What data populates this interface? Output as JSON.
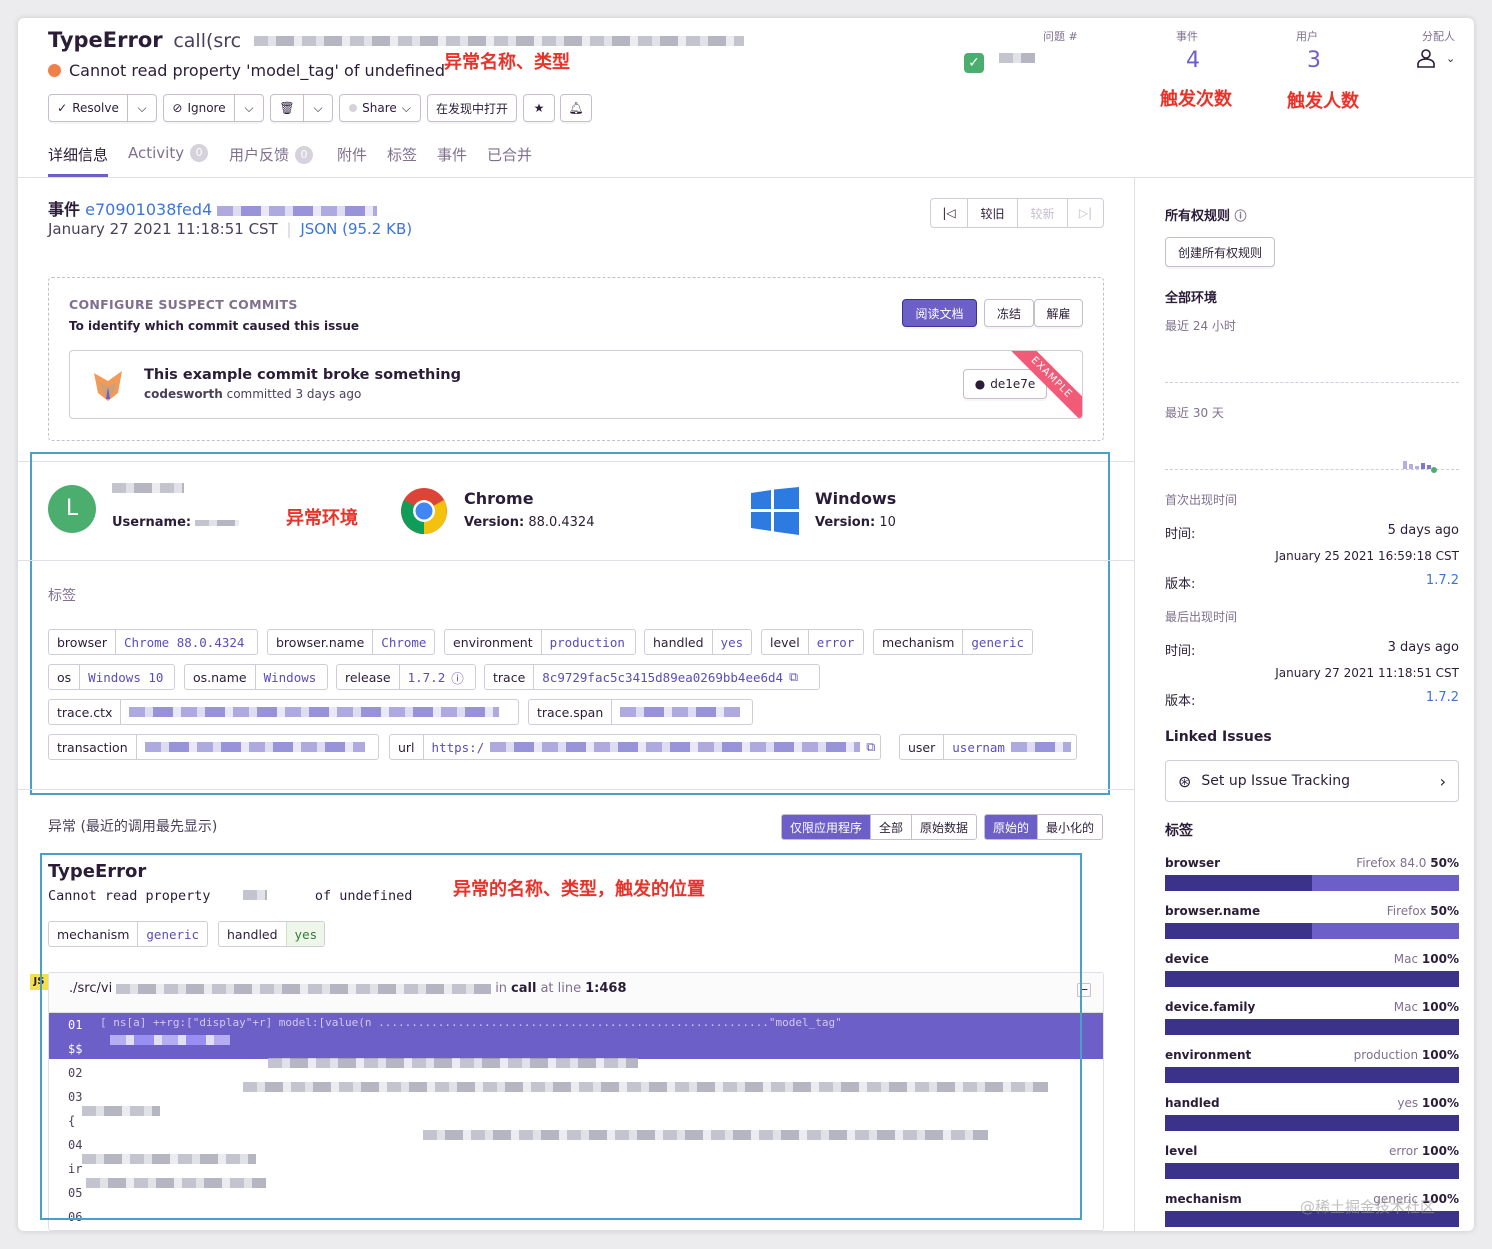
{
  "header": {
    "title": "TypeError",
    "culprit": "call(src",
    "message": "Cannot read property 'model_tag' of undefined",
    "issue_label": "问题 #",
    "events_label": "事件",
    "events_count": "4",
    "users_label": "用户",
    "users_count": "3",
    "assignee_label": "分配人"
  },
  "annotations": {
    "name_type": "异常名称、类型",
    "trigger_count": "触发次数",
    "trigger_users": "触发人数",
    "environment": "异常环境",
    "name_type_position": "异常的名称、类型，触发的位置"
  },
  "toolbar": {
    "resolve": "Resolve",
    "ignore": "Ignore",
    "share": "Share",
    "open_in_discover": "在发现中打开"
  },
  "tabs": [
    {
      "label": "详细信息"
    },
    {
      "label": "Activity",
      "count": "0"
    },
    {
      "label": "用户反馈",
      "count": "0"
    },
    {
      "label": "附件"
    },
    {
      "label": "标签"
    },
    {
      "label": "事件"
    },
    {
      "label": "已合并"
    }
  ],
  "event": {
    "prefix": "事件",
    "id": "e70901038fed4",
    "date": "January 27 2021 11:18:51 CST",
    "json": "JSON (95.2 KB)",
    "older": "较旧",
    "newer": "较新"
  },
  "suspect": {
    "title": "CONFIGURE SUSPECT COMMITS",
    "subtitle": "To identify which commit caused this issue",
    "read_docs": "阅读文档",
    "snooze": "冻结",
    "dismiss": "解雇",
    "commit_message": "This example commit broke something",
    "commit_author": "codesworth",
    "commit_meta": "committed 3 days ago",
    "commit_hash": "de1e7e",
    "ribbon": "EXAMPLE"
  },
  "context": {
    "user_initial": "L",
    "username_label": "Username:",
    "browser_name": "Chrome",
    "browser_version_label": "Version:",
    "browser_version": "88.0.4324",
    "os_name": "Windows",
    "os_version_label": "Version:",
    "os_version": "10"
  },
  "tags_heading": "标签",
  "tags": [
    {
      "k": "browser",
      "v": "Chrome 88.0.4324"
    },
    {
      "k": "browser.name",
      "v": "Chrome"
    },
    {
      "k": "environment",
      "v": "production"
    },
    {
      "k": "handled",
      "v": "yes"
    },
    {
      "k": "level",
      "v": "error"
    },
    {
      "k": "mechanism",
      "v": "generic"
    },
    {
      "k": "os",
      "v": "Windows 10"
    },
    {
      "k": "os.name",
      "v": "Windows"
    },
    {
      "k": "release",
      "v": "1.7.2"
    },
    {
      "k": "trace",
      "v": "8c9729fac5c3415d89ea0269bb4ee6d4"
    },
    {
      "k": "trace.ctx"
    },
    {
      "k": "trace.span"
    },
    {
      "k": "transaction"
    },
    {
      "k": "url",
      "v": "https:/"
    },
    {
      "k": "user",
      "v": "usernam"
    }
  ],
  "exception": {
    "heading": "异常 (最近的调用最先显示)",
    "filters": [
      "仅限应用程序",
      "全部",
      "原始数据"
    ],
    "formats": [
      "原始的",
      "最小化的"
    ],
    "type": "TypeError",
    "msg_start": "Cannot read property",
    "msg_end": "of undefined",
    "mechanism_k": "mechanism",
    "mechanism_v": "generic",
    "handled_k": "handled",
    "handled_v": "yes",
    "frame_lang": "JS",
    "frame_path": "./src/vi",
    "frame_in": "in",
    "frame_fn": "call",
    "frame_at": "at line",
    "frame_line": "1:468",
    "code_line_1": "01",
    "code_line_1_text": "[ ns[a] ++rg:[\"display\"+r] model:[value(n ...........................................................\"model_tag\"",
    "code_line_2": "$$",
    "code_line_3": "02",
    "code_line_4": "03",
    "code_line_5": "{",
    "code_line_6": "04",
    "code_line_7": "ir",
    "code_line_8": "05",
    "code_line_9": "06"
  },
  "sidebar": {
    "ownership": "所有权规则",
    "create_ownership": "创建所有权规则",
    "all_env": "全部环境",
    "last24": "最近 24 小时",
    "last30": "最近 30 天",
    "first_seen": "首次出现时间",
    "time_label": "时间:",
    "first_time": "5 days ago",
    "first_date": "January 25 2021 16:59:18 CST",
    "version_label": "版本:",
    "first_version": "1.7.2",
    "last_seen": "最后出现时间",
    "last_time": "3 days ago",
    "last_date": "January 27 2021 11:18:51 CST",
    "last_version": "1.7.2",
    "linked": "Linked Issues",
    "setup_tracking": "Set up Issue Tracking",
    "tags_heading": "标签",
    "tag_bars": [
      {
        "name": "browser",
        "value": "Firefox 84.0",
        "pct": "50%"
      },
      {
        "name": "browser.name",
        "value": "Firefox",
        "pct": "50%"
      },
      {
        "name": "device",
        "value": "Mac",
        "pct": "100%"
      },
      {
        "name": "device.family",
        "value": "Mac",
        "pct": "100%"
      },
      {
        "name": "environment",
        "value": "production",
        "pct": "100%"
      },
      {
        "name": "handled",
        "value": "yes",
        "pct": "100%"
      },
      {
        "name": "level",
        "value": "error",
        "pct": "100%"
      },
      {
        "name": "mechanism",
        "value": "generic",
        "pct": "100%"
      }
    ],
    "watermark": "@稀土掘金技术社区"
  },
  "colors": {
    "accent": "#6c5fc7",
    "annotation": "#e8332a",
    "box": "#4aa0c8",
    "bar": "#3b3289"
  }
}
